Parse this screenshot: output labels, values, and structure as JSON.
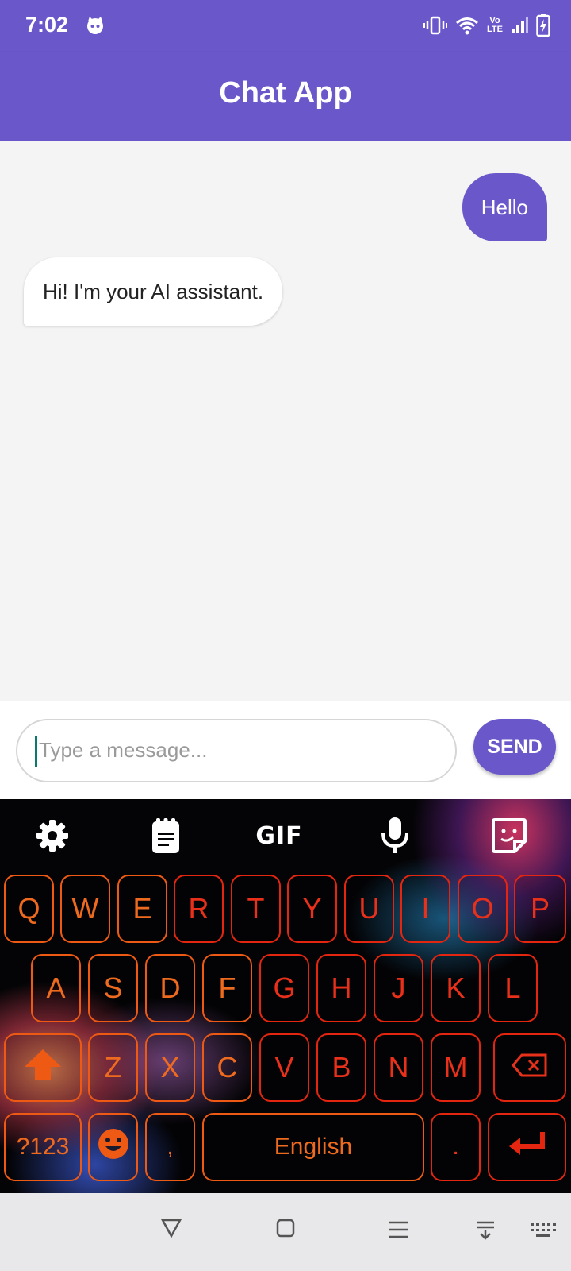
{
  "status_bar": {
    "time": "7:02",
    "icons": [
      "cat-notification-icon",
      "vibrate-icon",
      "wifi-icon",
      "volte-icon",
      "signal-icon",
      "battery-charging-icon"
    ],
    "volte_label": "Vo LTE"
  },
  "app_bar": {
    "title": "Chat App",
    "color": "#6a58cb"
  },
  "messages": [
    {
      "sender": "user",
      "text": "Hello"
    },
    {
      "sender": "assistant",
      "text": "Hi! I'm your AI assistant."
    }
  ],
  "composer": {
    "placeholder": "Type a message...",
    "value": "",
    "send_label": "SEND"
  },
  "keyboard": {
    "toolbar": {
      "settings": "gear-icon",
      "clipboard": "clipboard-icon",
      "gif_label": "GIF",
      "voice": "microphone-icon",
      "sticker": "sticker-icon"
    },
    "row1": [
      "Q",
      "W",
      "E",
      "R",
      "T",
      "Y",
      "U",
      "I",
      "O",
      "P"
    ],
    "row2": [
      "A",
      "S",
      "D",
      "F",
      "G",
      "H",
      "J",
      "K",
      "L"
    ],
    "row3": [
      "Z",
      "X",
      "C",
      "V",
      "B",
      "N",
      "M"
    ],
    "symbols_label": "?123",
    "comma_label": ",",
    "space_label": "English",
    "period_label": ".",
    "key_color": "#ee5a14",
    "key_accent_color": "#e42510"
  },
  "nav_bar": {
    "icons": [
      "back-icon",
      "home-icon",
      "recents-icon",
      "hide-keyboard-icon",
      "keyboard-switch-icon"
    ]
  }
}
